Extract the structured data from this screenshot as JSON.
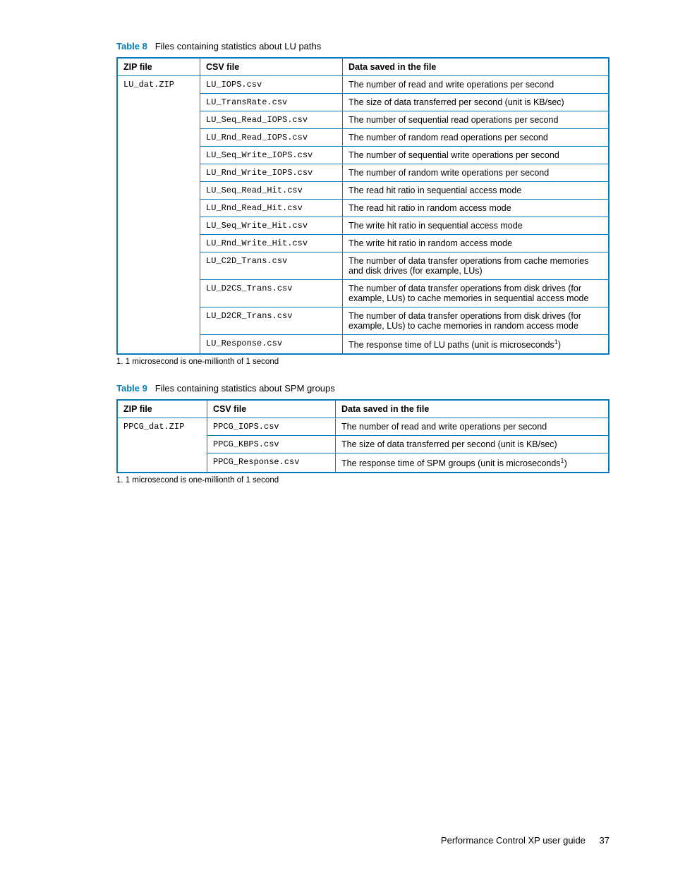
{
  "table8": {
    "label": "Table 8",
    "caption": "Files containing statistics about LU paths",
    "headers": [
      "ZIP file",
      "CSV file",
      "Data saved in the file"
    ],
    "zip": "LU_dat.ZIP",
    "rows": [
      {
        "csv": "LU_IOPS.csv",
        "desc": "The number of read and write operations per second"
      },
      {
        "csv": "LU_TransRate.csv",
        "desc": "The size of data transferred per second (unit is KB/sec)"
      },
      {
        "csv": "LU_Seq_Read_IOPS.csv",
        "desc": "The number of sequential read operations per second"
      },
      {
        "csv": "LU_Rnd_Read_IOPS.csv",
        "desc": "The number of random read operations per second"
      },
      {
        "csv": "LU_Seq_Write_IOPS.csv",
        "desc": "The number of sequential write operations per second"
      },
      {
        "csv": "LU_Rnd_Write_IOPS.csv",
        "desc": "The number of random write operations per second"
      },
      {
        "csv": "LU_Seq_Read_Hit.csv",
        "desc": "The read hit ratio in sequential access mode"
      },
      {
        "csv": "LU_Rnd_Read_Hit.csv",
        "desc": "The read hit ratio in random access mode"
      },
      {
        "csv": "LU_Seq_Write_Hit.csv",
        "desc": "The write hit ratio in sequential access mode"
      },
      {
        "csv": "LU_Rnd_Write_Hit.csv",
        "desc": "The write hit ratio in random access mode"
      },
      {
        "csv": "LU_C2D_Trans.csv",
        "desc": "The number of data transfer operations from cache memories and disk drives (for example, LUs)"
      },
      {
        "csv": "LU_D2CS_Trans.csv",
        "desc": "The number of data transfer operations from disk drives (for example, LUs) to cache memories in sequential access mode"
      },
      {
        "csv": "LU_D2CR_Trans.csv",
        "desc": "The number of data transfer operations from disk drives (for example, LUs) to cache memories in random access mode"
      },
      {
        "csv": "LU_Response.csv",
        "desc_pre": "The response time of LU paths (unit is microseconds",
        "sup": "1",
        "desc_post": ")"
      }
    ],
    "footnote": "1. 1 microsecond is one-millionth of 1 second"
  },
  "table9": {
    "label": "Table 9",
    "caption": "Files containing statistics about SPM groups",
    "headers": [
      "ZIP file",
      "CSV file",
      "Data saved in the file"
    ],
    "zip": "PPCG_dat.ZIP",
    "rows": [
      {
        "csv": "PPCG_IOPS.csv",
        "desc": "The number of read and write operations per second"
      },
      {
        "csv": "PPCG_KBPS.csv",
        "desc": "The size of data transferred per second (unit is KB/sec)"
      },
      {
        "csv": "PPCG_Response.csv",
        "desc_pre": "The response time of SPM groups (unit is microseconds",
        "sup": "1",
        "desc_post": ")"
      }
    ],
    "footnote": "1. 1 microsecond is one-millionth of 1 second"
  },
  "footer": {
    "title": "Performance Control XP user guide",
    "page": "37"
  }
}
